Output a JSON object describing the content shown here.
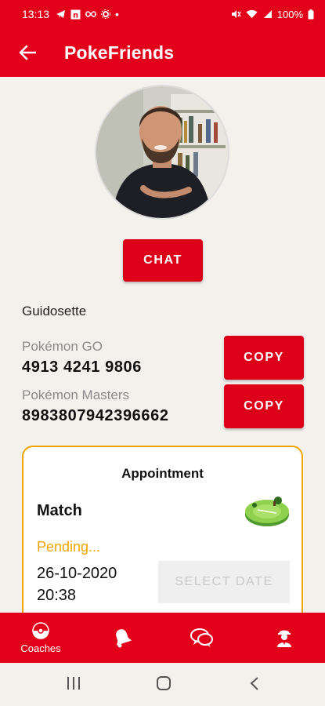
{
  "status_bar": {
    "time": "13:13",
    "battery": "100%"
  },
  "app_bar": {
    "title": "PokeFriends"
  },
  "profile": {
    "chat_label": "CHAT",
    "username": "Guidosette"
  },
  "games": [
    {
      "label": "Pokémon GO",
      "code": "4913 4241 9806",
      "copy_label": "COPY"
    },
    {
      "label": "Pokémon Masters",
      "code": "8983807942396662",
      "copy_label": "COPY"
    }
  ],
  "appointment": {
    "heading": "Appointment",
    "type": "Match",
    "status": "Pending...",
    "date": "26-10-2020",
    "time": "20:38",
    "select_label": "SELECT DATE"
  },
  "bottom_nav": {
    "items": [
      {
        "icon": "pokeball-icon",
        "label": "Coaches",
        "active": true
      },
      {
        "icon": "bell-icon"
      },
      {
        "icon": "chat-bubbles-icon"
      },
      {
        "icon": "coach-profile-icon"
      }
    ]
  },
  "colors": {
    "primary": "#e3001b",
    "accent": "#f0a500",
    "background": "#f4f1ed"
  }
}
